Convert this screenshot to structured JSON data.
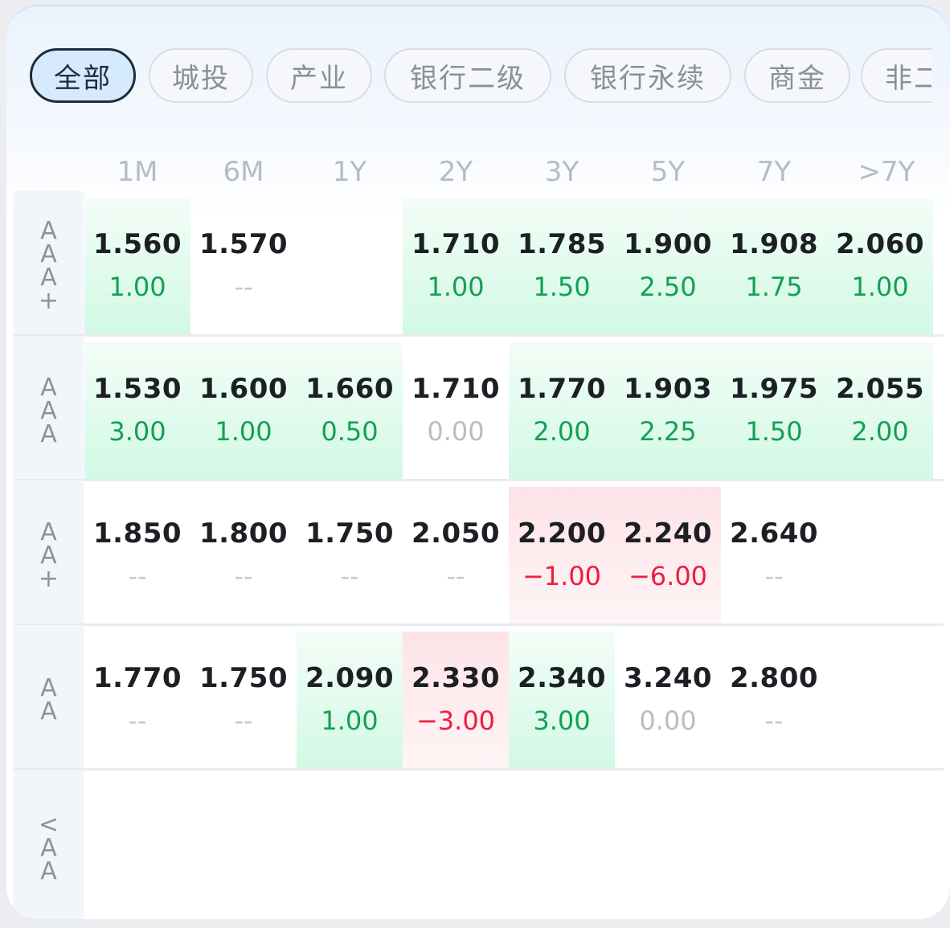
{
  "tabs": [
    {
      "label": "全部",
      "active": true
    },
    {
      "label": "城投",
      "active": false
    },
    {
      "label": "产业",
      "active": false
    },
    {
      "label": "银行二级",
      "active": false
    },
    {
      "label": "银行永续",
      "active": false
    },
    {
      "label": "商金",
      "active": false
    },
    {
      "label": "非二",
      "active": false
    }
  ],
  "columns": [
    "1M",
    "6M",
    "1Y",
    "2Y",
    "3Y",
    "5Y",
    "7Y",
    ">7Y"
  ],
  "rows": [
    {
      "label": "AAA+",
      "cells": [
        {
          "value": "1.560",
          "change": "1.00",
          "trend": "up"
        },
        {
          "value": "1.570",
          "change": "--",
          "trend": "none"
        },
        {
          "value": "",
          "change": "",
          "trend": "empty"
        },
        {
          "value": "1.710",
          "change": "1.00",
          "trend": "up"
        },
        {
          "value": "1.785",
          "change": "1.50",
          "trend": "up"
        },
        {
          "value": "1.900",
          "change": "2.50",
          "trend": "up"
        },
        {
          "value": "1.908",
          "change": "1.75",
          "trend": "up"
        },
        {
          "value": "2.060",
          "change": "1.00",
          "trend": "up"
        }
      ]
    },
    {
      "label": "AAA",
      "cells": [
        {
          "value": "1.530",
          "change": "3.00",
          "trend": "up"
        },
        {
          "value": "1.600",
          "change": "1.00",
          "trend": "up"
        },
        {
          "value": "1.660",
          "change": "0.50",
          "trend": "up"
        },
        {
          "value": "1.710",
          "change": "0.00",
          "trend": "zero"
        },
        {
          "value": "1.770",
          "change": "2.00",
          "trend": "up"
        },
        {
          "value": "1.903",
          "change": "2.25",
          "trend": "up"
        },
        {
          "value": "1.975",
          "change": "1.50",
          "trend": "up"
        },
        {
          "value": "2.055",
          "change": "2.00",
          "trend": "up"
        }
      ]
    },
    {
      "label": "AA+",
      "cells": [
        {
          "value": "1.850",
          "change": "--",
          "trend": "none"
        },
        {
          "value": "1.800",
          "change": "--",
          "trend": "none"
        },
        {
          "value": "1.750",
          "change": "--",
          "trend": "none"
        },
        {
          "value": "2.050",
          "change": "--",
          "trend": "none"
        },
        {
          "value": "2.200",
          "change": "−1.00",
          "trend": "down"
        },
        {
          "value": "2.240",
          "change": "−6.00",
          "trend": "down"
        },
        {
          "value": "2.640",
          "change": "--",
          "trend": "none"
        },
        {
          "value": "",
          "change": "",
          "trend": "empty"
        }
      ]
    },
    {
      "label": "AA",
      "cells": [
        {
          "value": "1.770",
          "change": "--",
          "trend": "none"
        },
        {
          "value": "1.750",
          "change": "--",
          "trend": "none"
        },
        {
          "value": "2.090",
          "change": "1.00",
          "trend": "up"
        },
        {
          "value": "2.330",
          "change": "−3.00",
          "trend": "down"
        },
        {
          "value": "2.340",
          "change": "3.00",
          "trend": "up"
        },
        {
          "value": "3.240",
          "change": "0.00",
          "trend": "zero"
        },
        {
          "value": "2.800",
          "change": "--",
          "trend": "none"
        },
        {
          "value": "",
          "change": "",
          "trend": "empty"
        }
      ]
    },
    {
      "label": "<AA",
      "cells": []
    }
  ],
  "colors": {
    "positive": "#12a150",
    "negative": "#ee1c3f",
    "neutral": "#b7bdc6",
    "active_tab_bg": "#d6eafd"
  }
}
